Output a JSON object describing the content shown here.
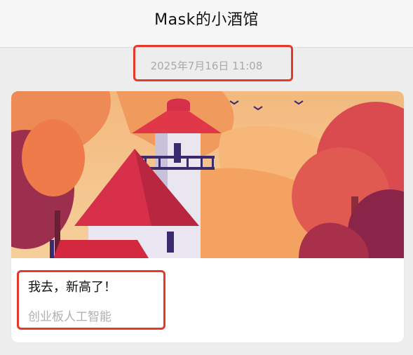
{
  "header": {
    "title": "Mask的小酒馆"
  },
  "message": {
    "timestamp": "2025年7月16日 11:08"
  },
  "article": {
    "title": "我去，新高了！",
    "subtitle": "创业板人工智能"
  },
  "highlight_color": "#e53a2b",
  "icons": [
    "bird-icon"
  ]
}
